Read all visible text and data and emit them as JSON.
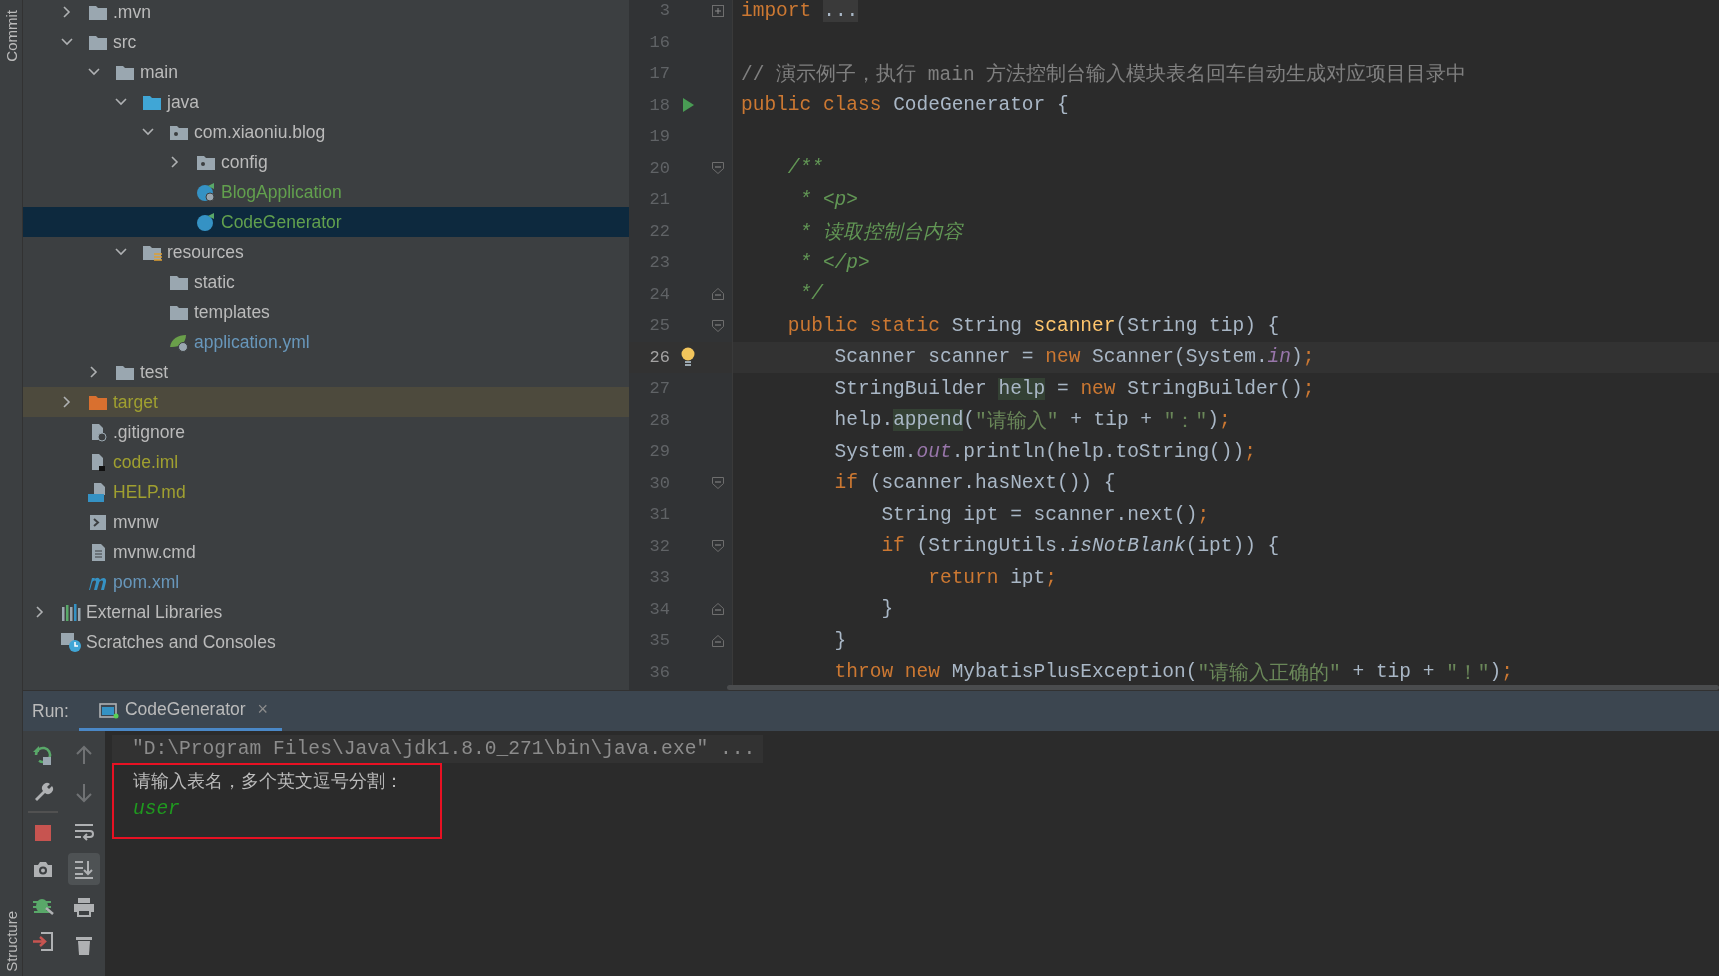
{
  "left_stripe": {
    "top_tool": "Commit",
    "bottom_tool": "Structure"
  },
  "project_tree": {
    "items": [
      {
        "name": ".mvn",
        "kind": "folder",
        "color": "#bbbbbb",
        "selected": false,
        "expanded": false
      },
      {
        "name": "src",
        "kind": "folder",
        "color": "#bbbbbb",
        "selected": false,
        "expanded": true,
        "children": [
          {
            "name": "main",
            "kind": "folder",
            "color": "#bbbbbb",
            "selected": false,
            "expanded": true,
            "children": [
              {
                "name": "java",
                "kind": "source-folder",
                "color": "#bbbbbb",
                "selected": false,
                "expanded": true,
                "children": [
                  {
                    "name": "com.xiaoniu.blog",
                    "kind": "package",
                    "color": "#bbbbbb",
                    "selected": false,
                    "expanded": true,
                    "children": [
                      {
                        "name": "config",
                        "kind": "package",
                        "color": "#bbbbbb",
                        "selected": false,
                        "expanded": false
                      },
                      {
                        "name": "BlogApplication",
                        "kind": "spring-class",
                        "color": "#62a04e",
                        "selected": false
                      },
                      {
                        "name": "CodeGenerator",
                        "kind": "class",
                        "color": "#62a04e",
                        "selected": true
                      }
                    ]
                  }
                ]
              },
              {
                "name": "resources",
                "kind": "resources-folder",
                "color": "#bbbbbb",
                "selected": false,
                "expanded": true,
                "children": [
                  {
                    "name": "static",
                    "kind": "folder",
                    "color": "#bbbbbb",
                    "selected": false
                  },
                  {
                    "name": "templates",
                    "kind": "folder",
                    "color": "#bbbbbb",
                    "selected": false
                  },
                  {
                    "name": "application.yml",
                    "kind": "yaml",
                    "color": "#6897bb",
                    "selected": false
                  }
                ]
              }
            ]
          },
          {
            "name": "test",
            "kind": "folder",
            "color": "#bbbbbb",
            "selected": false,
            "expanded": false
          }
        ]
      },
      {
        "name": "target",
        "kind": "excluded-folder",
        "color": "#a0a030",
        "selected": false,
        "expanded": false
      },
      {
        "name": ".gitignore",
        "kind": "ignore-file",
        "color": "#bbbbbb",
        "selected": false
      },
      {
        "name": "code.iml",
        "kind": "module-file",
        "color": "#a0a030",
        "selected": false
      },
      {
        "name": "HELP.md",
        "kind": "markdown",
        "color": "#a0a030",
        "selected": false
      },
      {
        "name": "mvnw",
        "kind": "script",
        "color": "#bbbbbb",
        "selected": false
      },
      {
        "name": "mvnw.cmd",
        "kind": "text-file",
        "color": "#bbbbbb",
        "selected": false
      },
      {
        "name": "pom.xml",
        "kind": "maven",
        "color": "#6897bb",
        "selected": false
      }
    ],
    "top_items": [
      {
        "name": "External Libraries",
        "kind": "libraries",
        "color": "#bbbbbb",
        "selected": false,
        "expanded": false
      },
      {
        "name": "Scratches and Consoles",
        "kind": "scratches",
        "color": "#bbbbbb",
        "selected": false
      }
    ]
  },
  "editor": {
    "lines": [
      {
        "number": "3",
        "current": false,
        "fold_marker": {
          "kind": "collapsed"
        },
        "tokens": [
          {
            "text": "import",
            "kind": "kw"
          },
          {
            "text": "...",
            "kind": "folded"
          }
        ]
      },
      {
        "number": "16",
        "current": false
      },
      {
        "number": "17",
        "current": false,
        "tokens": [
          {
            "text": "// 演示例子，执行 main 方法控制台输入模块表名回车自动生成对应项目目录中",
            "kind": "comment"
          }
        ]
      },
      {
        "number": "18",
        "current": false,
        "gutter_icon": {
          "kind": "run"
        },
        "tokens": [
          {
            "text": "public class ",
            "kind": "kw"
          },
          {
            "text": "CodeGenerator {",
            "kind": "plain"
          }
        ]
      },
      {
        "number": "19",
        "current": false
      },
      {
        "number": "20",
        "current": false,
        "fold_marker": {
          "kind": "open"
        },
        "tokens": [
          {
            "text": "    /**",
            "kind": "doc"
          }
        ]
      },
      {
        "number": "21",
        "current": false,
        "tokens": [
          {
            "text": "     * <p>",
            "kind": "doc"
          }
        ]
      },
      {
        "number": "22",
        "current": false,
        "tokens": [
          {
            "text": "     * 读取控制台内容",
            "kind": "doc"
          }
        ]
      },
      {
        "number": "23",
        "current": false,
        "tokens": [
          {
            "text": "     * </p>",
            "kind": "doc"
          }
        ]
      },
      {
        "number": "24",
        "current": false,
        "fold_marker": {
          "kind": "close"
        },
        "tokens": [
          {
            "text": "     */",
            "kind": "doc"
          }
        ]
      },
      {
        "number": "25",
        "current": false,
        "fold_marker": {
          "kind": "open"
        },
        "tokens": [
          {
            "text": "    public static ",
            "kind": "kw"
          },
          {
            "text": "String ",
            "kind": "plain"
          },
          {
            "text": "scanner",
            "kind": "fn"
          },
          {
            "text": "(String tip) {",
            "kind": "plain"
          }
        ]
      },
      {
        "number": "26",
        "current": true,
        "gutter_icon": {
          "kind": "bulb"
        },
        "tokens": [
          {
            "text": "        Scanner scanner = ",
            "kind": "plain"
          },
          {
            "text": "new ",
            "kind": "kw"
          },
          {
            "text": "Scanner(System.",
            "kind": "plain"
          },
          {
            "text": "in",
            "kind": "field"
          },
          {
            "text": ")",
            "kind": "plain"
          },
          {
            "text": ";",
            "kind": "kw"
          }
        ]
      },
      {
        "number": "27",
        "current": false,
        "tokens": [
          {
            "text": "        StringBuilder ",
            "kind": "plain"
          },
          {
            "text": "help",
            "kind": "usage"
          },
          {
            "text": " = ",
            "kind": "plain"
          },
          {
            "text": "new ",
            "kind": "kw"
          },
          {
            "text": "StringBuilder()",
            "kind": "plain"
          },
          {
            "text": ";",
            "kind": "kw"
          }
        ]
      },
      {
        "number": "28",
        "current": false,
        "tokens": [
          {
            "text": "        help.",
            "kind": "plain"
          },
          {
            "text": "append",
            "kind": "usage"
          },
          {
            "text": "(",
            "kind": "plain"
          },
          {
            "text": "\"请输入\"",
            "kind": "str"
          },
          {
            "text": " + tip + ",
            "kind": "plain"
          },
          {
            "text": "\"：\"",
            "kind": "str"
          },
          {
            "text": ")",
            "kind": "plain"
          },
          {
            "text": ";",
            "kind": "kw"
          }
        ]
      },
      {
        "number": "29",
        "current": false,
        "tokens": [
          {
            "text": "        System.",
            "kind": "plain"
          },
          {
            "text": "out",
            "kind": "field"
          },
          {
            "text": ".println(help.toString())",
            "kind": "plain"
          },
          {
            "text": ";",
            "kind": "kw"
          }
        ]
      },
      {
        "number": "30",
        "current": false,
        "fold_marker": {
          "kind": "open"
        },
        "tokens": [
          {
            "text": "        if ",
            "kind": "kw"
          },
          {
            "text": "(scanner.hasNext()) {",
            "kind": "plain"
          }
        ]
      },
      {
        "number": "31",
        "current": false,
        "tokens": [
          {
            "text": "            String ipt = scanner.next()",
            "kind": "plain"
          },
          {
            "text": ";",
            "kind": "kw"
          }
        ]
      },
      {
        "number": "32",
        "current": false,
        "fold_marker": {
          "kind": "open"
        },
        "tokens": [
          {
            "text": "            if ",
            "kind": "kw"
          },
          {
            "text": "(StringUtils.",
            "kind": "plain"
          },
          {
            "text": "isNotBlank",
            "kind": "static"
          },
          {
            "text": "(ipt)) {",
            "kind": "plain"
          }
        ]
      },
      {
        "number": "33",
        "current": false,
        "tokens": [
          {
            "text": "                return ",
            "kind": "kw"
          },
          {
            "text": "ipt",
            "kind": "plain"
          },
          {
            "text": ";",
            "kind": "kw"
          }
        ]
      },
      {
        "number": "34",
        "current": false,
        "fold_marker": {
          "kind": "close"
        },
        "tokens": [
          {
            "text": "            }",
            "kind": "plain"
          }
        ]
      },
      {
        "number": "35",
        "current": false,
        "fold_marker": {
          "kind": "close"
        },
        "tokens": [
          {
            "text": "        }",
            "kind": "plain"
          }
        ]
      },
      {
        "number": "36",
        "current": false,
        "tokens": [
          {
            "text": "        throw new ",
            "kind": "kw"
          },
          {
            "text": "MybatisPlusException(",
            "kind": "plain"
          },
          {
            "text": "\"请输入正确的\"",
            "kind": "str"
          },
          {
            "text": " + tip + ",
            "kind": "plain"
          },
          {
            "text": "\"！\"",
            "kind": "str"
          },
          {
            "text": ")",
            "kind": "plain"
          },
          {
            "text": ";",
            "kind": "kw"
          }
        ]
      }
    ]
  },
  "run_panel": {
    "label": "Run:",
    "tabs": [
      {
        "title": "CodeGenerator",
        "selected": true,
        "close": "×"
      }
    ],
    "toolbar_left": [
      {
        "kind": "rerun"
      },
      {
        "kind": "settings"
      },
      {
        "kind": "stop"
      },
      {
        "kind": "screenshot"
      },
      {
        "kind": "debug"
      },
      {
        "kind": "exit"
      }
    ],
    "toolbar_right": [
      {
        "kind": "up",
        "disabled": true
      },
      {
        "kind": "down",
        "disabled": true
      },
      {
        "kind": "wrap",
        "on": false,
        "disabled": false
      },
      {
        "kind": "scroll-end",
        "on": true,
        "disabled": false
      },
      {
        "kind": "print",
        "on": false,
        "disabled": false
      },
      {
        "kind": "trash",
        "on": false,
        "disabled": false
      }
    ],
    "console": {
      "command": "\"D:\\Program Files\\Java\\jdk1.8.0_271\\bin\\java.exe\" ...",
      "output": [
        {
          "text": "请输入表名，多个英文逗号分割：",
          "kind": "stdout"
        },
        {
          "text": "user",
          "kind": "input"
        }
      ]
    }
  }
}
